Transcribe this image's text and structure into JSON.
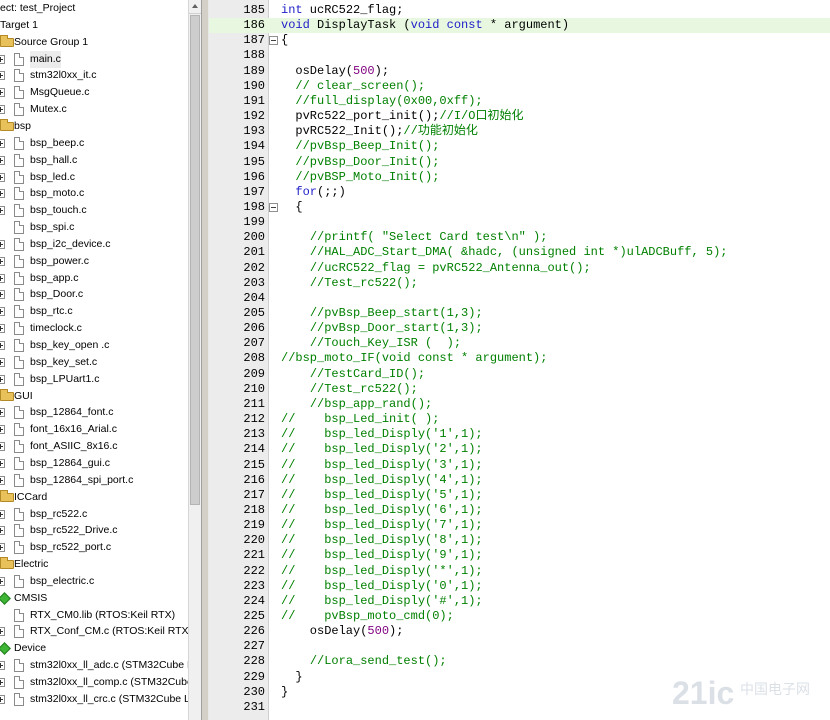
{
  "tree": {
    "rows": [
      {
        "label": "ect: test_Project",
        "icon": "none",
        "indent": 0,
        "exp": "none"
      },
      {
        "label": "Target 1",
        "icon": "none",
        "indent": 0,
        "exp": "none"
      },
      {
        "label": "Source Group 1",
        "icon": "folder",
        "indent": 1,
        "exp": "minus"
      },
      {
        "label": "main.c",
        "icon": "file",
        "indent": 2,
        "exp": "plus",
        "selected": true
      },
      {
        "label": "stm32l0xx_it.c",
        "icon": "file",
        "indent": 2,
        "exp": "plus"
      },
      {
        "label": "MsgQueue.c",
        "icon": "file",
        "indent": 2,
        "exp": "plus"
      },
      {
        "label": "Mutex.c",
        "icon": "file",
        "indent": 2,
        "exp": "plus"
      },
      {
        "label": "bsp",
        "icon": "folder",
        "indent": 1,
        "exp": "minus"
      },
      {
        "label": "bsp_beep.c",
        "icon": "file",
        "indent": 2,
        "exp": "plus"
      },
      {
        "label": "bsp_hall.c",
        "icon": "file",
        "indent": 2,
        "exp": "plus"
      },
      {
        "label": "bsp_led.c",
        "icon": "file",
        "indent": 2,
        "exp": "plus"
      },
      {
        "label": "bsp_moto.c",
        "icon": "file",
        "indent": 2,
        "exp": "plus"
      },
      {
        "label": "bsp_touch.c",
        "icon": "file",
        "indent": 2,
        "exp": "plus"
      },
      {
        "label": "bsp_spi.c",
        "icon": "file",
        "indent": 2,
        "exp": "none"
      },
      {
        "label": "bsp_i2c_device.c",
        "icon": "file",
        "indent": 2,
        "exp": "plus"
      },
      {
        "label": "bsp_power.c",
        "icon": "file",
        "indent": 2,
        "exp": "plus"
      },
      {
        "label": "bsp_app.c",
        "icon": "file",
        "indent": 2,
        "exp": "plus"
      },
      {
        "label": "bsp_Door.c",
        "icon": "file",
        "indent": 2,
        "exp": "plus"
      },
      {
        "label": "bsp_rtc.c",
        "icon": "file",
        "indent": 2,
        "exp": "plus"
      },
      {
        "label": "timeclock.c",
        "icon": "file",
        "indent": 2,
        "exp": "plus"
      },
      {
        "label": "bsp_key_open .c",
        "icon": "file",
        "indent": 2,
        "exp": "plus"
      },
      {
        "label": "bsp_key_set.c",
        "icon": "file",
        "indent": 2,
        "exp": "plus"
      },
      {
        "label": "bsp_LPUart1.c",
        "icon": "file",
        "indent": 2,
        "exp": "plus"
      },
      {
        "label": "GUI",
        "icon": "folder",
        "indent": 1,
        "exp": "minus"
      },
      {
        "label": "bsp_12864_font.c",
        "icon": "file",
        "indent": 2,
        "exp": "plus"
      },
      {
        "label": "font_16x16_Arial.c",
        "icon": "file",
        "indent": 2,
        "exp": "plus"
      },
      {
        "label": "font_ASIIC_8x16.c",
        "icon": "file",
        "indent": 2,
        "exp": "plus"
      },
      {
        "label": "bsp_12864_gui.c",
        "icon": "file",
        "indent": 2,
        "exp": "plus"
      },
      {
        "label": "bsp_12864_spi_port.c",
        "icon": "file",
        "indent": 2,
        "exp": "plus"
      },
      {
        "label": "ICCard",
        "icon": "folder",
        "indent": 1,
        "exp": "minus"
      },
      {
        "label": "bsp_rc522.c",
        "icon": "file",
        "indent": 2,
        "exp": "plus"
      },
      {
        "label": "bsp_rc522_Drive.c",
        "icon": "file",
        "indent": 2,
        "exp": "plus"
      },
      {
        "label": "bsp_rc522_port.c",
        "icon": "file",
        "indent": 2,
        "exp": "plus"
      },
      {
        "label": "Electric",
        "icon": "folder",
        "indent": 1,
        "exp": "minus"
      },
      {
        "label": "bsp_electric.c",
        "icon": "file",
        "indent": 2,
        "exp": "plus"
      },
      {
        "label": "CMSIS",
        "icon": "diamond",
        "indent": 1,
        "exp": "none"
      },
      {
        "label": "RTX_CM0.lib (RTOS:Keil RTX)",
        "icon": "file",
        "indent": 2,
        "exp": "none"
      },
      {
        "label": "RTX_Conf_CM.c (RTOS:Keil RTX)",
        "icon": "file",
        "indent": 2,
        "exp": "plus"
      },
      {
        "label": "Device",
        "icon": "diamond",
        "indent": 1,
        "exp": "none"
      },
      {
        "label": "stm32l0xx_ll_adc.c (STM32Cube LL:",
        "icon": "file",
        "indent": 2,
        "exp": "plus"
      },
      {
        "label": "stm32l0xx_ll_comp.c (STM32Cube LL:",
        "icon": "file",
        "indent": 2,
        "exp": "plus"
      },
      {
        "label": "stm32l0xx_ll_crc.c (STM32Cube LL:",
        "icon": "file",
        "indent": 2,
        "exp": "plus"
      }
    ]
  },
  "editor": {
    "lines": [
      {
        "n": "185",
        "parts": [
          [
            "kw",
            "int"
          ],
          [
            "t",
            " ucRC522_flag;"
          ]
        ]
      },
      {
        "n": "186",
        "hl": true,
        "parts": [
          [
            "kw",
            "void"
          ],
          [
            "t",
            " DisplayTask ("
          ],
          [
            "kw",
            "void const"
          ],
          [
            "t",
            " * argument)"
          ]
        ]
      },
      {
        "n": "187",
        "fold": true,
        "parts": [
          [
            "t",
            "{"
          ]
        ]
      },
      {
        "n": "188",
        "parts": []
      },
      {
        "n": "189",
        "parts": [
          [
            "t",
            "  osDelay("
          ],
          [
            "num",
            "500"
          ],
          [
            "t",
            ");"
          ]
        ]
      },
      {
        "n": "190",
        "parts": [
          [
            "t",
            "  "
          ],
          [
            "cm",
            "// clear_screen();"
          ]
        ]
      },
      {
        "n": "191",
        "parts": [
          [
            "t",
            "  "
          ],
          [
            "cm",
            "//full_display(0x00,0xff);"
          ]
        ]
      },
      {
        "n": "192",
        "parts": [
          [
            "t",
            "  pvRc522_port_init();"
          ],
          [
            "cm",
            "//I/O口初始化"
          ]
        ]
      },
      {
        "n": "193",
        "parts": [
          [
            "t",
            "  pvRC522_Init();"
          ],
          [
            "cm",
            "//功能初始化"
          ]
        ]
      },
      {
        "n": "194",
        "parts": [
          [
            "t",
            "  "
          ],
          [
            "cm",
            "//pvBsp_Beep_Init();"
          ]
        ]
      },
      {
        "n": "195",
        "parts": [
          [
            "t",
            "  "
          ],
          [
            "cm",
            "//pvBsp_Door_Init();"
          ]
        ]
      },
      {
        "n": "196",
        "parts": [
          [
            "t",
            "  "
          ],
          [
            "cm",
            "//pvBSP_Moto_Init();"
          ]
        ]
      },
      {
        "n": "197",
        "parts": [
          [
            "t",
            "  "
          ],
          [
            "kw",
            "for"
          ],
          [
            "t",
            "(;;)"
          ]
        ]
      },
      {
        "n": "198",
        "fold": true,
        "parts": [
          [
            "t",
            "  {"
          ]
        ]
      },
      {
        "n": "199",
        "parts": []
      },
      {
        "n": "200",
        "parts": [
          [
            "t",
            "    "
          ],
          [
            "cm",
            "//printf( \"Select Card test\\n\" );"
          ]
        ]
      },
      {
        "n": "201",
        "parts": [
          [
            "t",
            "    "
          ],
          [
            "cm",
            "//HAL_ADC_Start_DMA( &hadc, (unsigned int *)ulADCBuff, 5);"
          ]
        ]
      },
      {
        "n": "202",
        "parts": [
          [
            "t",
            "    "
          ],
          [
            "cm",
            "//ucRC522_flag = pvRC522_Antenna_out();"
          ]
        ]
      },
      {
        "n": "203",
        "parts": [
          [
            "t",
            "    "
          ],
          [
            "cm",
            "//Test_rc522();"
          ]
        ]
      },
      {
        "n": "204",
        "parts": []
      },
      {
        "n": "205",
        "parts": [
          [
            "t",
            "    "
          ],
          [
            "cm",
            "//pvBsp_Beep_start(1,3);"
          ]
        ]
      },
      {
        "n": "206",
        "parts": [
          [
            "t",
            "    "
          ],
          [
            "cm",
            "//pvBsp_Door_start(1,3);"
          ]
        ]
      },
      {
        "n": "207",
        "parts": [
          [
            "t",
            "    "
          ],
          [
            "cm",
            "//Touch_Key_ISR (  );"
          ]
        ]
      },
      {
        "n": "208",
        "parts": [
          [
            "cm",
            "//bsp_moto_IF(void const * argument);"
          ]
        ]
      },
      {
        "n": "209",
        "parts": [
          [
            "t",
            "    "
          ],
          [
            "cm",
            "//TestCard_ID();"
          ]
        ]
      },
      {
        "n": "210",
        "parts": [
          [
            "t",
            "    "
          ],
          [
            "cm",
            "//Test_rc522();"
          ]
        ]
      },
      {
        "n": "211",
        "parts": [
          [
            "t",
            "    "
          ],
          [
            "cm",
            "//bsp_app_rand();"
          ]
        ]
      },
      {
        "n": "212",
        "parts": [
          [
            "cm",
            "//    bsp_Led_init( );"
          ]
        ]
      },
      {
        "n": "213",
        "parts": [
          [
            "cm",
            "//    bsp_led_Disply('1',1);"
          ]
        ]
      },
      {
        "n": "214",
        "parts": [
          [
            "cm",
            "//    bsp_led_Disply('2',1);"
          ]
        ]
      },
      {
        "n": "215",
        "parts": [
          [
            "cm",
            "//    bsp_led_Disply('3',1);"
          ]
        ]
      },
      {
        "n": "216",
        "parts": [
          [
            "cm",
            "//    bsp_led_Disply('4',1);"
          ]
        ]
      },
      {
        "n": "217",
        "parts": [
          [
            "cm",
            "//    bsp_led_Disply('5',1);"
          ]
        ]
      },
      {
        "n": "218",
        "parts": [
          [
            "cm",
            "//    bsp_led_Disply('6',1);"
          ]
        ]
      },
      {
        "n": "219",
        "parts": [
          [
            "cm",
            "//    bsp_led_Disply('7',1);"
          ]
        ]
      },
      {
        "n": "220",
        "parts": [
          [
            "cm",
            "//    bsp_led_Disply('8',1);"
          ]
        ]
      },
      {
        "n": "221",
        "parts": [
          [
            "cm",
            "//    bsp_led_Disply('9',1);"
          ]
        ]
      },
      {
        "n": "222",
        "parts": [
          [
            "cm",
            "//    bsp_led_Disply('*',1);"
          ]
        ]
      },
      {
        "n": "223",
        "parts": [
          [
            "cm",
            "//    bsp_led_Disply('0',1);"
          ]
        ]
      },
      {
        "n": "224",
        "parts": [
          [
            "cm",
            "//    bsp_led_Disply('#',1);"
          ]
        ]
      },
      {
        "n": "225",
        "parts": [
          [
            "cm",
            "//    pvBsp_moto_cmd(0);"
          ]
        ]
      },
      {
        "n": "226",
        "parts": [
          [
            "t",
            "    osDelay("
          ],
          [
            "num",
            "500"
          ],
          [
            "t",
            ");"
          ]
        ]
      },
      {
        "n": "227",
        "parts": []
      },
      {
        "n": "228",
        "parts": [
          [
            "t",
            "    "
          ],
          [
            "cm",
            "//Lora_send_test();"
          ]
        ]
      },
      {
        "n": "229",
        "parts": [
          [
            "t",
            "  }"
          ]
        ]
      },
      {
        "n": "230",
        "parts": [
          [
            "t",
            "}"
          ]
        ]
      },
      {
        "n": "231",
        "parts": []
      }
    ]
  },
  "watermark": {
    "brand": "21ic",
    "subtitle": "中国电子网"
  }
}
